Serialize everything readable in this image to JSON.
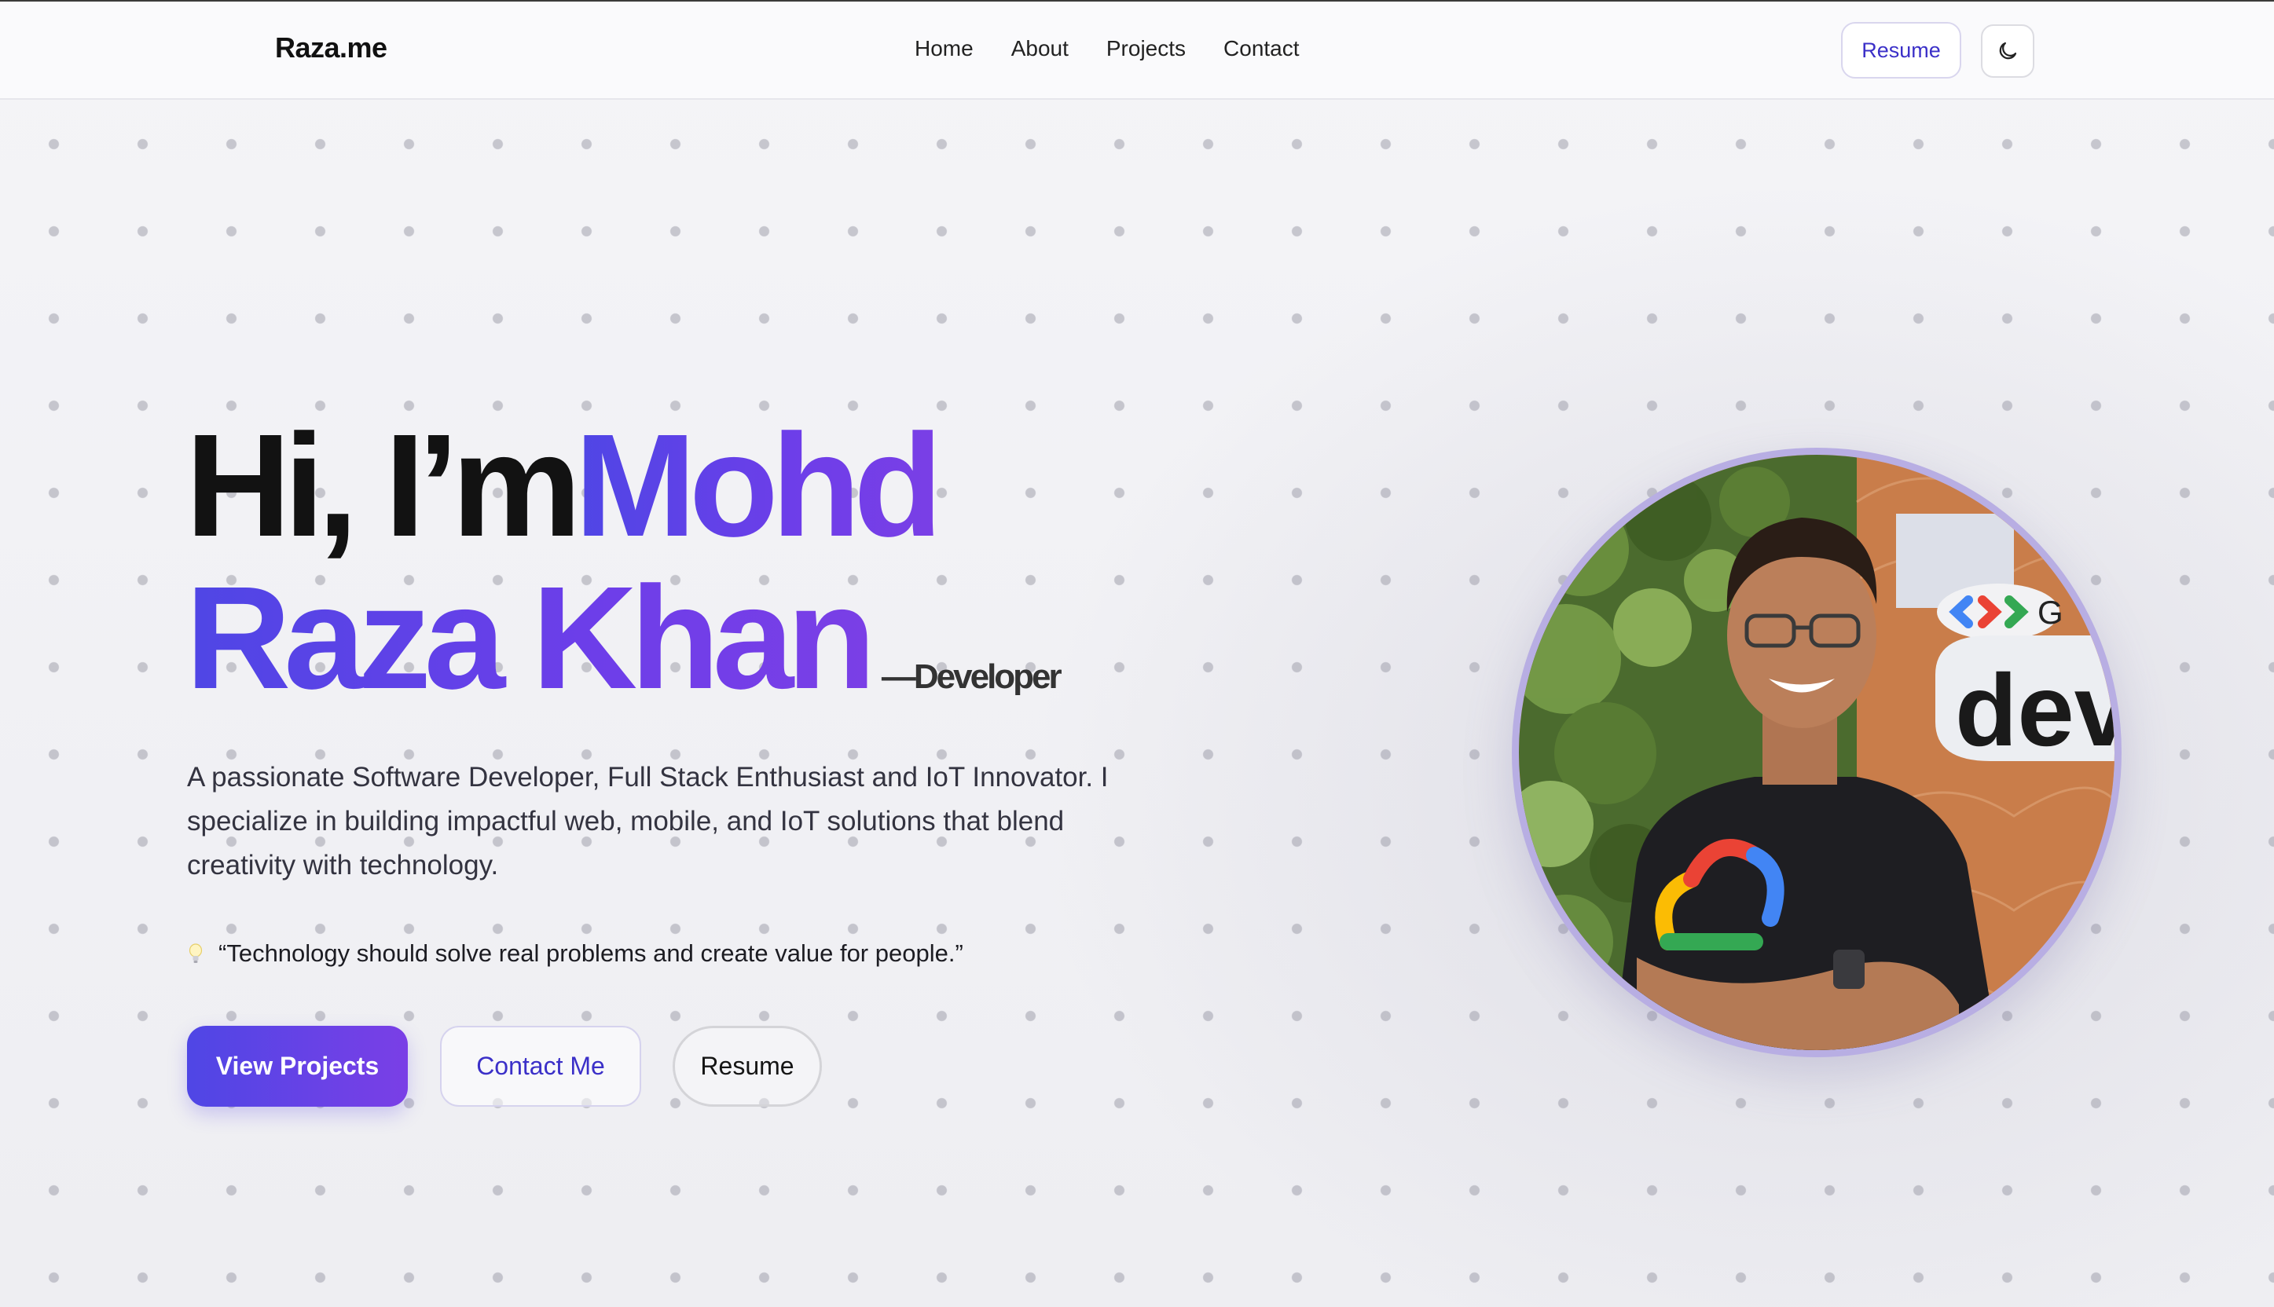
{
  "navbar": {
    "brand": "Raza.me",
    "links": [
      {
        "label": "Home"
      },
      {
        "label": "About"
      },
      {
        "label": "Projects"
      },
      {
        "label": "Contact"
      }
    ],
    "resume_label": "Resume",
    "theme_icon": "moon-icon"
  },
  "hero": {
    "greeting": "Hi, I’m",
    "name_first": "Mohd",
    "name_rest": "Raza Khan",
    "role": "—Developer",
    "tagline": "A passionate Software Developer, Full Stack Enthusiast and IoT Innovator. I specialize in building impactful web, mobile, and IoT solutions that blend creativity with technology.",
    "quote_icon": "lightbulb-icon",
    "quote": "“Technology should solve real problems and create value for people.”",
    "buttons": {
      "view_projects": "View Projects",
      "contact_me": "Contact Me",
      "resume": "Resume"
    },
    "photo": {
      "sign_letter": "G",
      "sign_text": "dev"
    }
  },
  "colors": {
    "accent": "#4f46e5",
    "accent_end": "#7a3fe6",
    "text": "#121212",
    "avatar_ring": "#b8aee3"
  }
}
